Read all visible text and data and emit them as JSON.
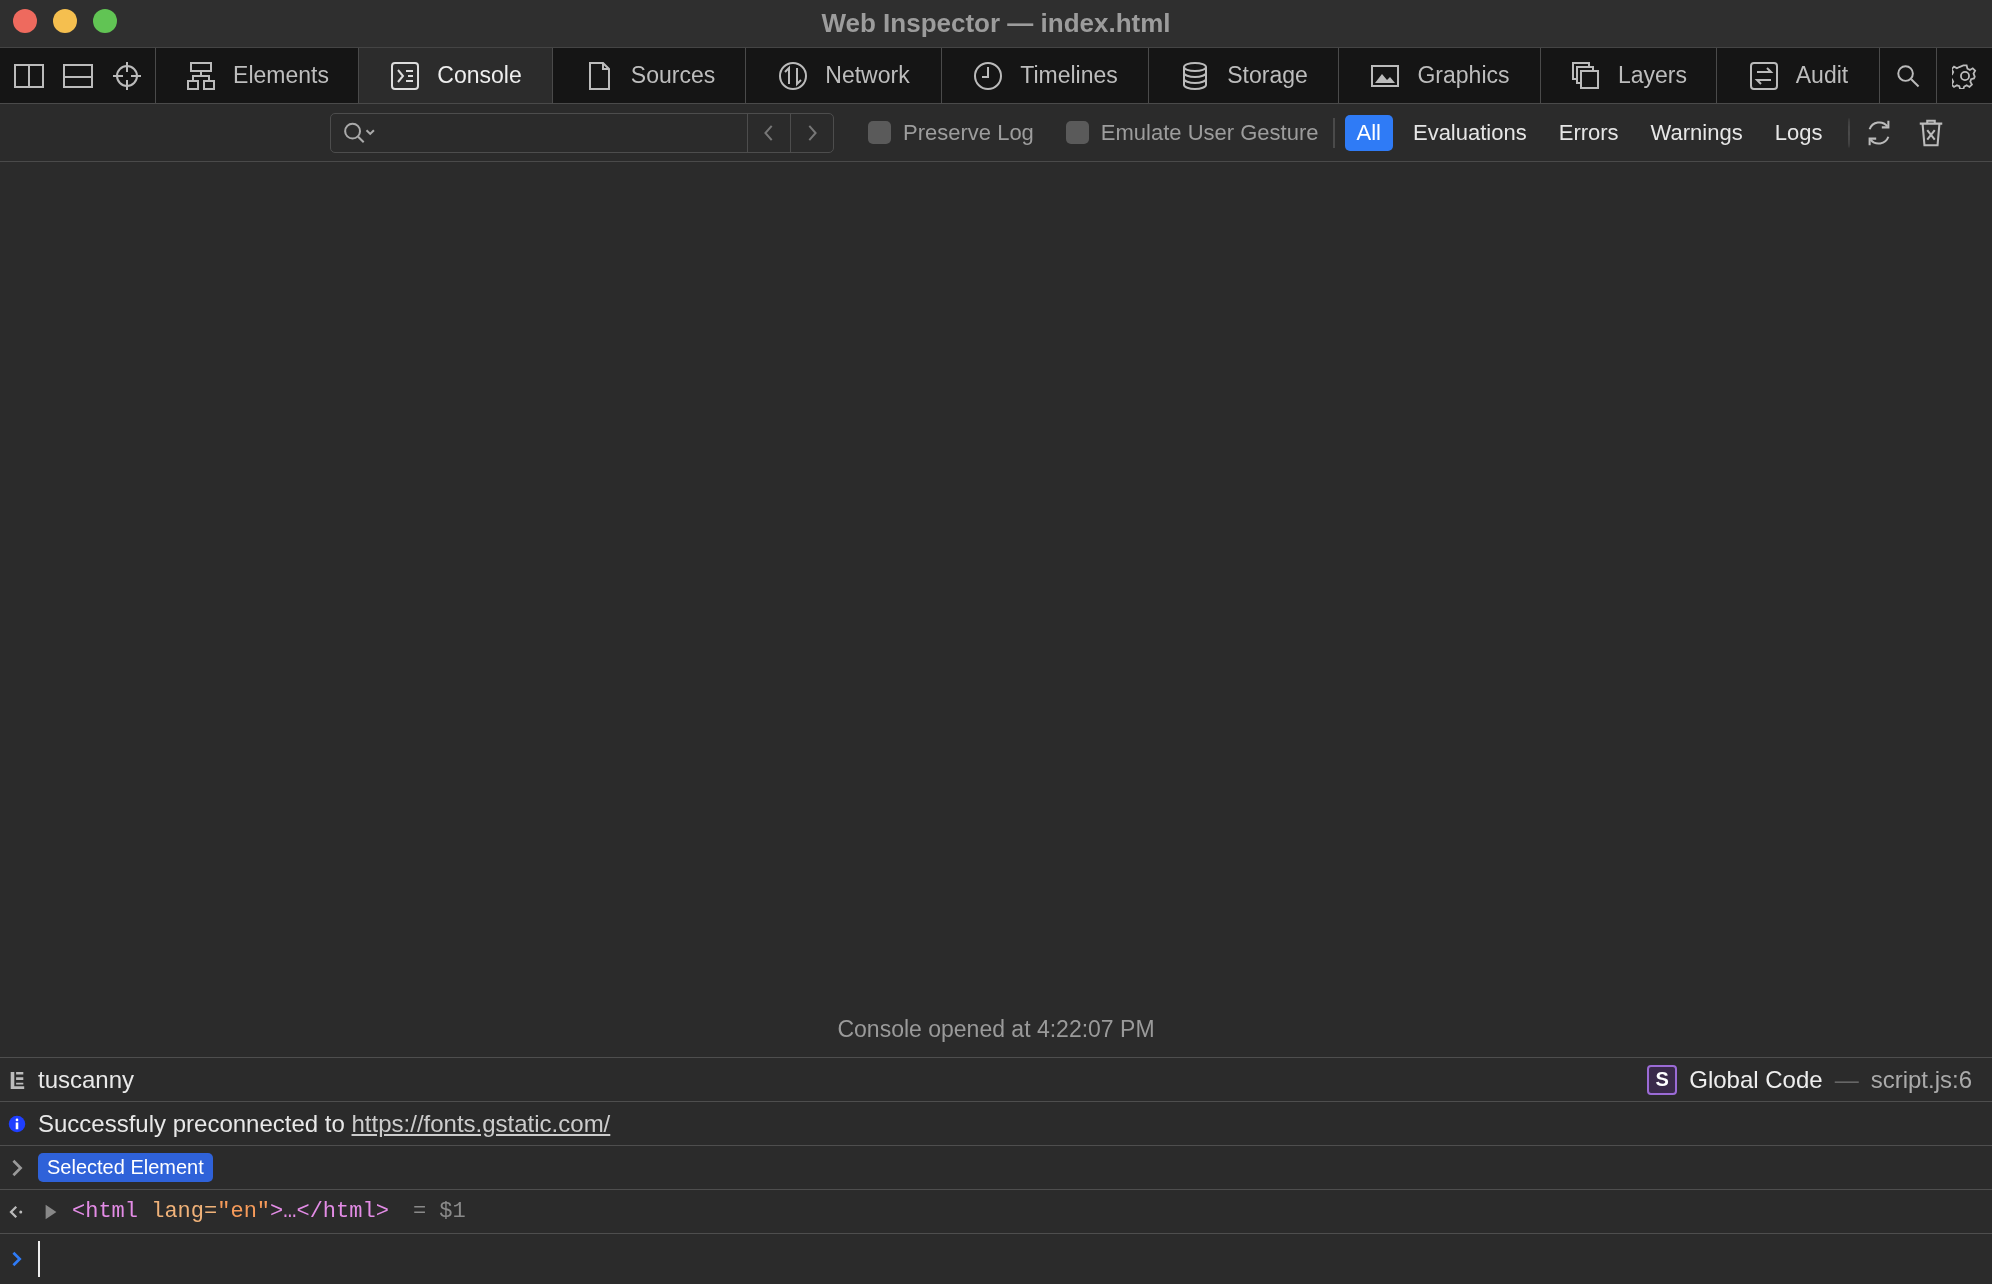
{
  "window": {
    "title": "Web Inspector — index.html"
  },
  "tabs": [
    {
      "label": "Elements",
      "selected": false
    },
    {
      "label": "Console",
      "selected": true
    },
    {
      "label": "Sources",
      "selected": false
    },
    {
      "label": "Network",
      "selected": false
    },
    {
      "label": "Timelines",
      "selected": false
    },
    {
      "label": "Storage",
      "selected": false
    },
    {
      "label": "Graphics",
      "selected": false
    },
    {
      "label": "Layers",
      "selected": false
    },
    {
      "label": "Audit",
      "selected": false
    }
  ],
  "filter_bar": {
    "checkboxes": [
      {
        "label": "Preserve Log",
        "checked": false
      },
      {
        "label": "Emulate User Gesture",
        "checked": false
      }
    ],
    "filters": [
      {
        "label": "All",
        "selected": true
      },
      {
        "label": "Evaluations",
        "selected": false
      },
      {
        "label": "Errors",
        "selected": false
      },
      {
        "label": "Warnings",
        "selected": false
      },
      {
        "label": "Logs",
        "selected": false
      }
    ]
  },
  "console": {
    "opened_message": "Console opened at 4:22:07 PM",
    "messages": [
      {
        "kind": "log",
        "text": "tuscanny",
        "source": {
          "badge": "S",
          "function": "Global Code",
          "separator": "—",
          "location": "script.js:6"
        }
      },
      {
        "kind": "info",
        "text": "Successfuly preconnected to",
        "link": "https://fonts.gstatic.com/"
      },
      {
        "kind": "badge",
        "badge": "Selected Element",
        "expanded": false
      },
      {
        "kind": "result",
        "expanded": false,
        "tokens": [
          {
            "kind": "tag",
            "text": "<html "
          },
          {
            "kind": "attr",
            "text": "lang="
          },
          {
            "kind": "value",
            "text": "\"en\""
          },
          {
            "kind": "tag",
            "text": ">…</html>"
          }
        ],
        "assignment": "= $1"
      }
    ]
  }
}
